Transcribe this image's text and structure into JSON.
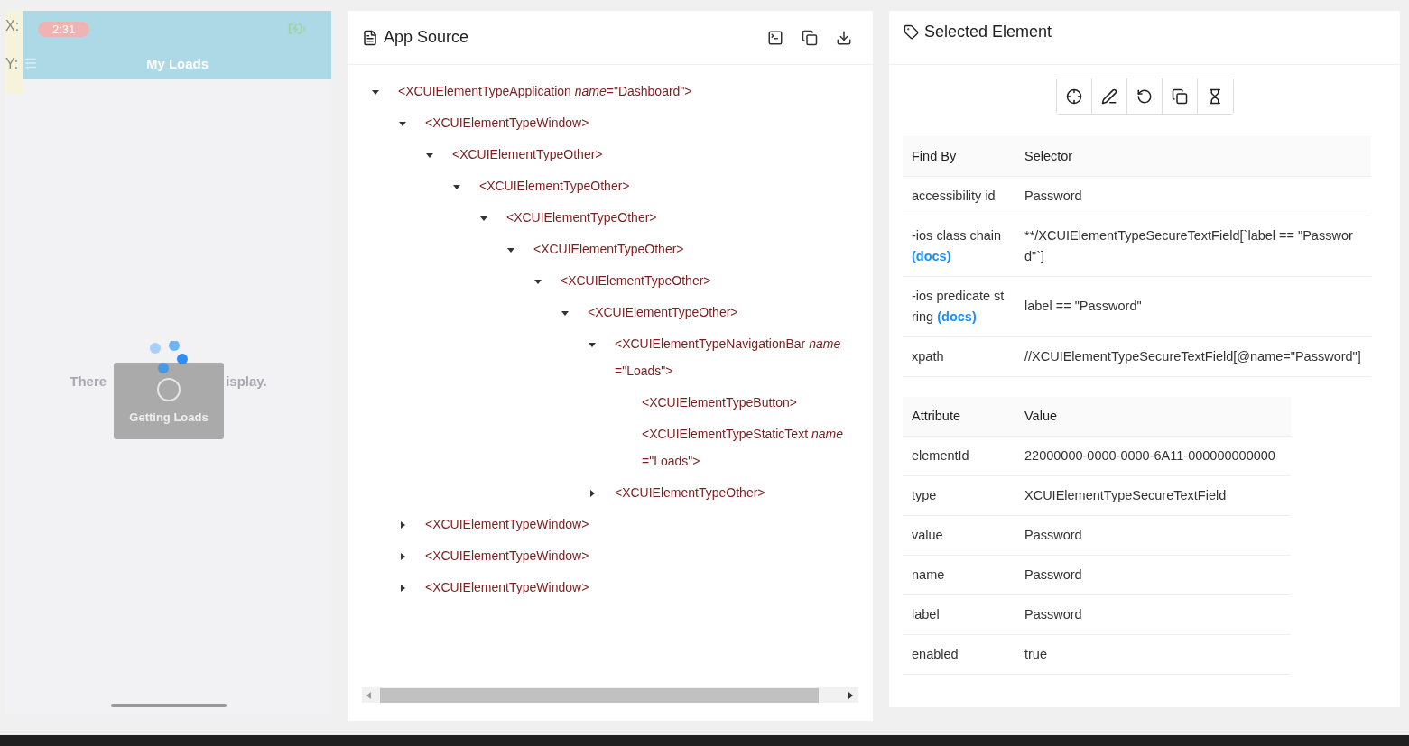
{
  "phone": {
    "coords": [
      {
        "label": "X:"
      },
      {
        "label": "Y:"
      }
    ],
    "status_time": "2:31",
    "nav_title": "My Loads",
    "empty_text_left": "There",
    "empty_text_right": "isplay.",
    "loader_text": "Getting Loads"
  },
  "source": {
    "title": "App Source",
    "tree": [
      {
        "text": "<XCUIElementTypeApplication *name*=\"Dashboard\">",
        "kind": "branch",
        "expanded": true,
        "children": [
          {
            "text": "<XCUIElementTypeWindow>",
            "kind": "branch",
            "expanded": true,
            "children": [
              {
                "text": "<XCUIElementTypeOther>",
                "kind": "branch",
                "expanded": true,
                "children": [
                  {
                    "text": "<XCUIElementTypeOther>",
                    "kind": "branch",
                    "expanded": true,
                    "children": [
                      {
                        "text": "<XCUIElementTypeOther>",
                        "kind": "branch",
                        "expanded": true,
                        "children": [
                          {
                            "text": "<XCUIElementTypeOther>",
                            "kind": "branch",
                            "expanded": true,
                            "children": [
                              {
                                "text": "<XCUIElementTypeOther>",
                                "kind": "branch",
                                "expanded": true,
                                "children": [
                                  {
                                    "text": "<XCUIElementTypeOther>",
                                    "kind": "branch",
                                    "expanded": true,
                                    "children": [
                                      {
                                        "text": "<XCUIElementTypeNavigationBar *name*=\"Loads\">",
                                        "kind": "branch",
                                        "expanded": true,
                                        "children": [
                                          {
                                            "text": "<XCUIElementTypeButton>",
                                            "kind": "leaf"
                                          },
                                          {
                                            "text": "<XCUIElementTypeStaticText *name*=\"Loads\">",
                                            "kind": "leaf"
                                          }
                                        ]
                                      },
                                      {
                                        "text": "<XCUIElementTypeOther>",
                                        "kind": "branch",
                                        "expanded": false
                                      }
                                    ]
                                  }
                                ]
                              }
                            ]
                          }
                        ]
                      }
                    ]
                  }
                ]
              }
            ]
          },
          {
            "text": "<XCUIElementTypeWindow>",
            "kind": "branch",
            "expanded": false
          },
          {
            "text": "<XCUIElementTypeWindow>",
            "kind": "branch",
            "expanded": false
          },
          {
            "text": "<XCUIElementTypeWindow>",
            "kind": "branch",
            "expanded": false
          }
        ]
      }
    ]
  },
  "selected": {
    "title": "Selected Element",
    "selectors": {
      "columns": [
        "Find By",
        "Selector"
      ],
      "rows": [
        {
          "find_by": "accessibility id",
          "selector": "Password"
        },
        {
          "find_by": "-ios class chain",
          "docs": "(docs)",
          "selector": "**/XCUIElementTypeSecureTextField[`label == \"Password\"`]"
        },
        {
          "find_by": "-ios predicate string",
          "docs": "(docs)",
          "selector": "label == \"Password\""
        },
        {
          "find_by": "xpath",
          "selector": "//XCUIElementTypeSecureTextField[@name=\"Password\"]"
        }
      ]
    },
    "attributes": {
      "columns": [
        "Attribute",
        "Value"
      ],
      "rows": [
        {
          "attribute": "elementId",
          "value": "22000000-0000-0000-6A11-000000000000"
        },
        {
          "attribute": "type",
          "value": "XCUIElementTypeSecureTextField"
        },
        {
          "attribute": "value",
          "value": "Password"
        },
        {
          "attribute": "name",
          "value": "Password"
        },
        {
          "attribute": "label",
          "value": "Password"
        },
        {
          "attribute": "enabled",
          "value": "true"
        }
      ]
    }
  },
  "taskbar": {
    "kind": "dark"
  }
}
